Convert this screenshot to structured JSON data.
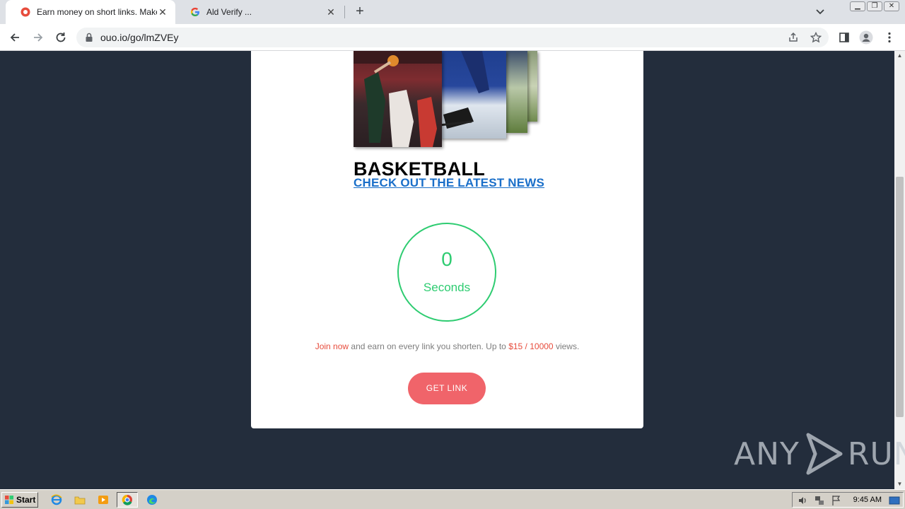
{
  "browser": {
    "tabs": [
      {
        "title": "Earn money on short links. Make sho",
        "active": true
      },
      {
        "title": "Ald Verify ...",
        "active": false
      }
    ],
    "url": "ouo.io/go/lmZVEy"
  },
  "page": {
    "news": {
      "title": "BASKETBALL",
      "link_text": "CHECK OUT THE LATEST NEWS"
    },
    "timer": {
      "count": "0",
      "label": "Seconds"
    },
    "promo": {
      "join": "Join now",
      "middle": " and earn on every link you shorten. Up to ",
      "rate": "$15 / 10000",
      "end": " views."
    },
    "get_link_label": "GET LINK"
  },
  "watermark": {
    "left": "ANY",
    "right": "RUN"
  },
  "taskbar": {
    "start_label": "Start",
    "clock": "9:45 AM"
  },
  "colors": {
    "page_background": "#232d3c",
    "timer_green": "#2ecc71",
    "accent_red": "#e74c3c",
    "button_red": "#f0646a",
    "link_blue": "#1a6fc9"
  }
}
